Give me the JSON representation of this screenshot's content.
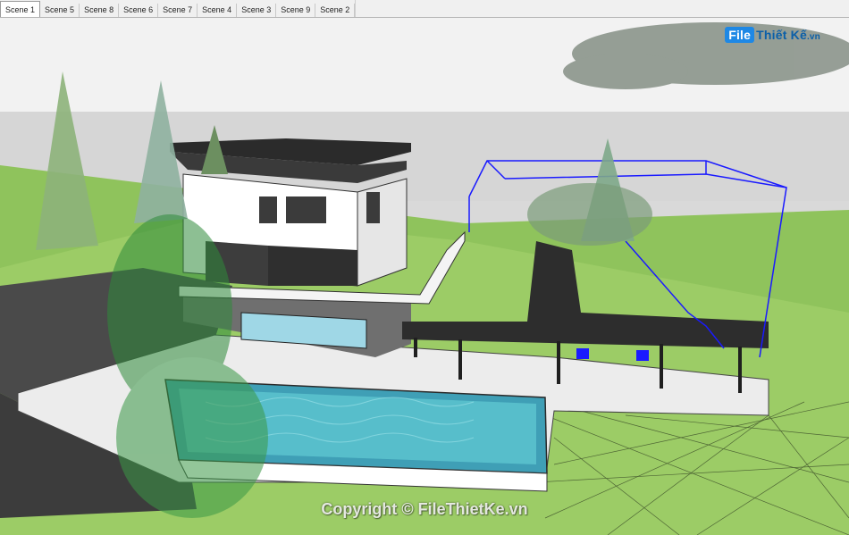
{
  "tabs": [
    {
      "label": "Scene 1",
      "active": true
    },
    {
      "label": "Scene 5",
      "active": false
    },
    {
      "label": "Scene 8",
      "active": false
    },
    {
      "label": "Scene 6",
      "active": false
    },
    {
      "label": "Scene 7",
      "active": false
    },
    {
      "label": "Scene 4",
      "active": false
    },
    {
      "label": "Scene 3",
      "active": false
    },
    {
      "label": "Scene 9",
      "active": false
    },
    {
      "label": "Scene 2",
      "active": false
    }
  ],
  "watermark": {
    "logo_badge": "File",
    "logo_text": "Thiết Kế",
    "logo_suffix": ".vn",
    "copyright": "Copyright © FileThietKe.vn"
  },
  "colors": {
    "sky": "#d8d8d8",
    "grass": "#8cc25a",
    "pool": "#4fb4c2",
    "roof": "#2b2b2b",
    "selection": "#1a1aff"
  }
}
